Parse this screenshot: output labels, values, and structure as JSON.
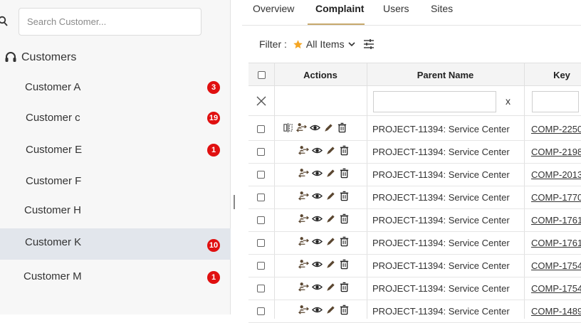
{
  "sidebar": {
    "search_placeholder": "Search Customer...",
    "heading": "Customers",
    "items": [
      {
        "label": "Customer A",
        "badge": "3"
      },
      {
        "label": "Customer c",
        "badge": "19"
      },
      {
        "label": "Customer E",
        "badge": "1"
      },
      {
        "label": "Customer F",
        "badge": ""
      },
      {
        "label": "Customer H",
        "badge": ""
      },
      {
        "label": "Customer K",
        "badge": "10",
        "active": true
      },
      {
        "label": "Customer M",
        "badge": "1"
      }
    ]
  },
  "tabs": [
    {
      "label": "Overview"
    },
    {
      "label": "Complaint",
      "active": true
    },
    {
      "label": "Users"
    },
    {
      "label": "Sites"
    }
  ],
  "filter": {
    "label": "Filter :",
    "value": "All Items"
  },
  "table": {
    "columns": {
      "actions": "Actions",
      "parent_name": "Parent Name",
      "key": "Key"
    },
    "filter_clear": "x",
    "rows": [
      {
        "parent": "PROJECT-11394: Service Center",
        "key": "COMP-2250"
      },
      {
        "parent": "PROJECT-11394: Service Center",
        "key": "COMP-2198"
      },
      {
        "parent": "PROJECT-11394: Service Center",
        "key": "COMP-2013"
      },
      {
        "parent": "PROJECT-11394: Service Center",
        "key": "COMP-1770"
      },
      {
        "parent": "PROJECT-11394: Service Center",
        "key": "COMP-1761"
      },
      {
        "parent": "PROJECT-11394: Service Center",
        "key": "COMP-1761"
      },
      {
        "parent": "PROJECT-11394: Service Center",
        "key": "COMP-1754"
      },
      {
        "parent": "PROJECT-11394: Service Center",
        "key": "COMP-1754"
      },
      {
        "parent": "PROJECT-11394: Service Center",
        "key": "COMP-1489"
      }
    ]
  },
  "colors": {
    "accent_underline": "#c7a86c",
    "badge": "#e01010",
    "star": "#f5a623",
    "icon": "#5a4630"
  }
}
